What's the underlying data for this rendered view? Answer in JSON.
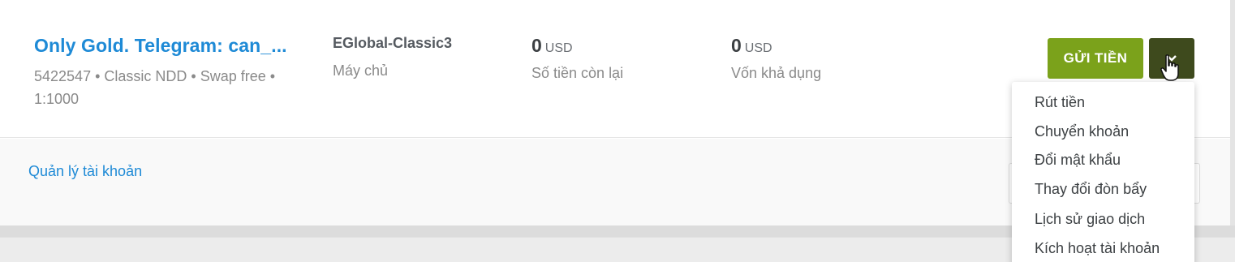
{
  "account": {
    "title": "Only Gold. Telegram: can_...",
    "meta": "5422547 • Classic NDD • Swap free • 1:1000"
  },
  "server": {
    "value": "EGlobal-Classic3",
    "label": "Máy chủ"
  },
  "balance": {
    "amount": "0",
    "currency": "USD",
    "label": "Số tiền còn lại"
  },
  "capital": {
    "amount": "0",
    "currency": "USD",
    "label": "Vốn khả dụng"
  },
  "actions": {
    "deposit_label": "GỬI TIỀN",
    "toggle_icon": "chevron-down-icon"
  },
  "manage_link": "Quản lý tài khoản",
  "menu": {
    "items": [
      {
        "label": "Rút tiền"
      },
      {
        "label": "Chuyển khoản"
      },
      {
        "label": "Đổi mật khẩu"
      },
      {
        "label": "Thay đổi đòn bẩy"
      },
      {
        "label": "Lịch sử giao dịch"
      },
      {
        "label": "Kích hoạt tài khoản"
      }
    ]
  },
  "colors": {
    "link": "#1e8ad6",
    "deposit": "#7ba21b",
    "toggle": "#3e4a1d"
  }
}
